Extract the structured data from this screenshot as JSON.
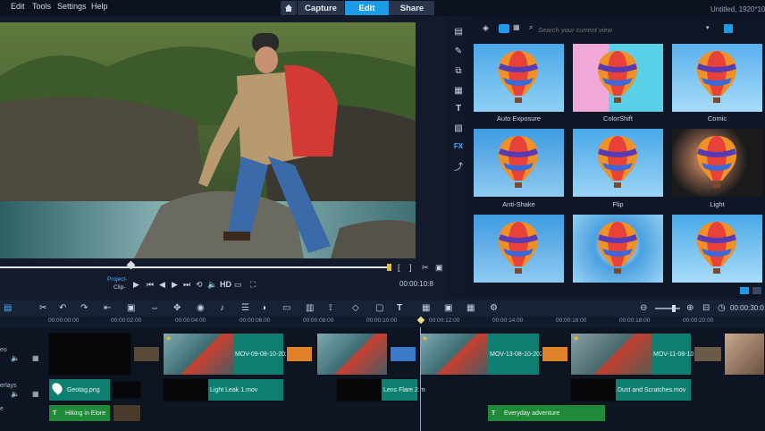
{
  "menu": [
    "Edit",
    "Tools",
    "Settings",
    "Help"
  ],
  "tabs": {
    "capture": "Capture",
    "edit": "Edit",
    "share": "Share"
  },
  "window_title": "Untitled, 1920*10",
  "player": {
    "project_label": "Project-",
    "clip_label": "Clip-",
    "hd_label": "HD",
    "timecode": "00:00:10:8",
    "playback_progress": 0.31
  },
  "sidebar_tools": [
    "media",
    "instant-project",
    "transition",
    "title",
    "graphics",
    "filter",
    "fx",
    "motion-path"
  ],
  "library": {
    "search_placeholder": "Search your current view",
    "effects": [
      {
        "name": "Auto Exposure"
      },
      {
        "name": "ColorShift"
      },
      {
        "name": "Comic"
      },
      {
        "name": "Anti-Shake"
      },
      {
        "name": "Flip"
      },
      {
        "name": "Light"
      },
      {
        "name": ""
      },
      {
        "name": ""
      },
      {
        "name": ""
      }
    ]
  },
  "timeline": {
    "timecode": "00:00:30:0",
    "ruler_ticks": [
      "00:00:00:00",
      "00:00:02:00",
      "00:00:04:00",
      "00:00:06:00",
      "00:00:08:00",
      "00:00:10:00",
      "00:00:12:00",
      "00:00:14:00",
      "00:00:16:00",
      "00:00:18:00",
      "00:00:20:00"
    ],
    "tracks": {
      "video_label": "eo",
      "overlay_label": "erlays",
      "title_label": "e"
    },
    "video_clips": [
      "MOV-09-08-10-2020.",
      "MOV-13-08-10-202(",
      "MOV-11-08-10-2020"
    ],
    "overlay_clips": [
      "Geotag.png",
      "Light Leak 1.mov",
      "Lens Flare 2.m",
      "Dust and Scratches.mov"
    ],
    "title_clips": [
      "Hiking in Elore",
      "Everyday adventure"
    ]
  },
  "colors": {
    "accent": "#1c9be8",
    "clip_teal": "#0f7f71",
    "clip_green": "#1f8b3a"
  }
}
